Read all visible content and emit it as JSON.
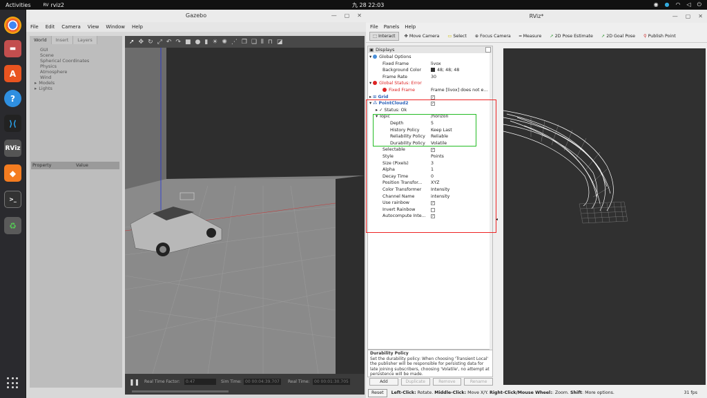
{
  "topbar": {
    "activities": "Activities",
    "app_name": "rviz2",
    "clock": "九 28  22:03"
  },
  "gazebo": {
    "title": "Gazebo",
    "menu": [
      "File",
      "Edit",
      "Camera",
      "View",
      "Window",
      "Help"
    ],
    "tabs": [
      "World",
      "Insert",
      "Layers"
    ],
    "tree": [
      "GUI",
      "Scene",
      "Spherical Coordinates",
      "Physics",
      "Atmosphere",
      "Wind",
      "Models",
      "Lights"
    ],
    "prop_header": {
      "property": "Property",
      "value": "Value"
    },
    "status": {
      "rtf_label": "Real Time Factor:",
      "rtf_value": "0.47",
      "sim_label": "Sim Time:",
      "sim_value": "00 00:04:39.707",
      "real_label": "Real Time:",
      "real_value": "00 00:01:30.705"
    }
  },
  "rviz": {
    "title": "RViz*",
    "menu": [
      "File",
      "Panels",
      "Help"
    ],
    "toolbar": [
      "Interact",
      "Move Camera",
      "Select",
      "Focus Camera",
      "Measure",
      "2D Pose Estimate",
      "2D Goal Pose",
      "Publish Point"
    ],
    "displays_title": "Displays",
    "rows": [
      {
        "label": "Global Options",
        "value": ""
      },
      {
        "label": "Fixed Frame",
        "value": "livox"
      },
      {
        "label": "Background Color",
        "value": "48; 48; 48"
      },
      {
        "label": "Frame Rate",
        "value": "30"
      },
      {
        "label": "Global Status: Error",
        "value": ""
      },
      {
        "label": "Fixed Frame",
        "value": "Frame [livox] does not e..."
      },
      {
        "label": "Grid",
        "value": ""
      },
      {
        "label": "PointCloud2",
        "value": ""
      },
      {
        "label": "Status: Ok",
        "value": ""
      },
      {
        "label": "Topic",
        "value": "/horizon"
      },
      {
        "label": "Depth",
        "value": "5"
      },
      {
        "label": "History Policy",
        "value": "Keep Last"
      },
      {
        "label": "Reliability Policy",
        "value": "Reliable"
      },
      {
        "label": "Durability Policy",
        "value": "Volatile"
      },
      {
        "label": "Selectable",
        "value": ""
      },
      {
        "label": "Style",
        "value": "Points"
      },
      {
        "label": "Size (Pixels)",
        "value": "3"
      },
      {
        "label": "Alpha",
        "value": "1"
      },
      {
        "label": "Decay Time",
        "value": "0"
      },
      {
        "label": "Position Transfor...",
        "value": "XYZ"
      },
      {
        "label": "Color Transformer",
        "value": "Intensity"
      },
      {
        "label": "Channel Name",
        "value": "intensity"
      },
      {
        "label": "Use rainbow",
        "value": ""
      },
      {
        "label": "Invert Rainbow",
        "value": ""
      },
      {
        "label": "Autocompute Inte...",
        "value": ""
      }
    ],
    "desc_title": "Durability Policy",
    "desc_text": "Set the durability policy: When choosing 'Transient Local' the publisher will be responsible for persisting data for late joining subscribers, choosing 'Volatile', no attempt at persistence will be made.",
    "buttons": [
      "Add",
      "Duplicate",
      "Remove",
      "Rename"
    ],
    "status": {
      "reset": "Reset",
      "hint_left_b": "Left-Click:",
      "hint_left": " Rotate. ",
      "hint_mid_b": "Middle-Click:",
      "hint_mid": " Move X/Y. ",
      "hint_right_b": "Right-Click/Mouse Wheel:",
      "hint_right": ": Zoom. ",
      "hint_shift_b": "Shift",
      "hint_shift": ": More options.",
      "fps": "31 fps"
    }
  },
  "colors": {
    "bg_color_swatch": "#303030",
    "error": "#dd2222",
    "highlight_red": "#ee2222",
    "highlight_green": "#22bb22"
  }
}
